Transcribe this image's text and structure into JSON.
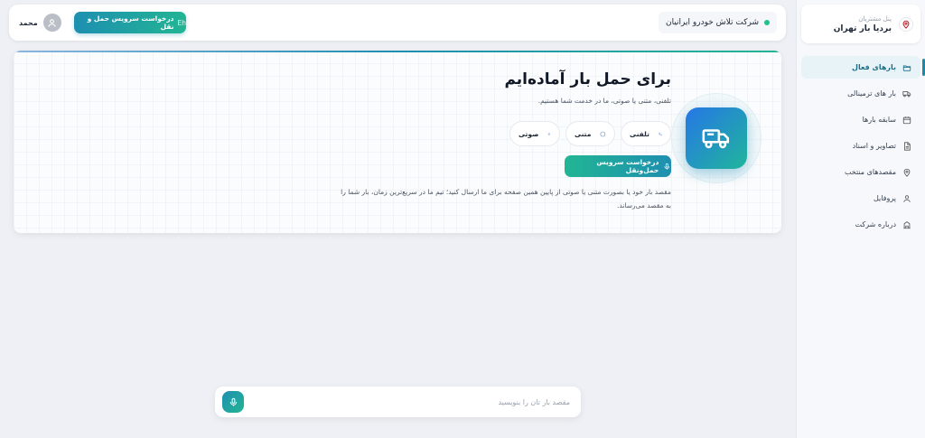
{
  "sidebar": {
    "brand_sub": "پنل مشتریان",
    "brand_name": "بردیا بار تهران",
    "items": [
      {
        "label": "بارهای فعال",
        "icon": "folder-open-icon",
        "active": true
      },
      {
        "label": "بار های ترمینالی",
        "icon": "truck-icon"
      },
      {
        "label": "سابقه بارها",
        "icon": "calendar-icon"
      },
      {
        "label": "تصاویر و اسناد",
        "icon": "document-icon"
      },
      {
        "label": "مقصدهای منتخب",
        "icon": "map-pin-icon"
      },
      {
        "label": "پروفایل",
        "icon": "user-icon"
      },
      {
        "label": "درباره شرکت",
        "icon": "building-icon"
      }
    ]
  },
  "header": {
    "company": "شرکت تلاش خودرو ایرانیان",
    "request_button": "درخواست سرویس حمل و نقل",
    "request_button_prefix": "Eh",
    "user_name": "محمد"
  },
  "hero": {
    "title": "برای حمل بار آماده‌ایم",
    "subtitle": "تلفنی، متنی یا صوتی، ما در خدمت شما هستیم.",
    "chips": [
      {
        "label": "تلفنی",
        "icon": "phone-icon"
      },
      {
        "label": "متنی",
        "icon": "chat-icon"
      },
      {
        "label": "صوتی",
        "icon": "microphone-icon"
      }
    ],
    "request_button": "درخواست سرویس حمل‌ونقل",
    "description": "مقصد بار خود یا بصورت متنی یا صوتی از پایین همین صفحه برای ما ارسال کنید؛ تیم ما در سریع‌ترین زمان، بار شما را به مقصد می‌رساند."
  },
  "composer": {
    "placeholder": "مقصد بار تان را بنویسید",
    "value": ""
  },
  "colors": {
    "accent_start": "#1e8fb0",
    "accent_end": "#22b594",
    "status_online": "#22c08a"
  }
}
